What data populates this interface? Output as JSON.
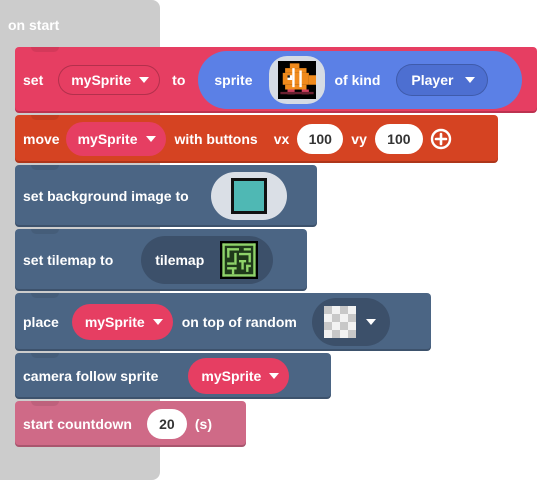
{
  "on_start": {
    "label": "on start"
  },
  "set_sprite": {
    "set_label": "set",
    "var": "mySprite",
    "to_label": "to",
    "sprite_label": "sprite",
    "of_kind_label": "of kind",
    "kind": "Player"
  },
  "move": {
    "label": "move",
    "var": "mySprite",
    "with_buttons_label": "with buttons",
    "vx_label": "vx",
    "vx_value": "100",
    "vy_label": "vy",
    "vy_value": "100"
  },
  "background": {
    "label": "set background image to"
  },
  "tilemap": {
    "label": "set tilemap to",
    "field_label": "tilemap"
  },
  "place": {
    "label": "place",
    "var": "mySprite",
    "on_top_label": "on top of random"
  },
  "camera": {
    "label": "camera follow sprite",
    "var": "mySprite"
  },
  "countdown": {
    "label": "start countdown",
    "value": "20",
    "unit": "(s)"
  },
  "colors": {
    "sprites": "#e63e62",
    "controller": "#d54322",
    "scene": "#4b6584",
    "info": "#cf6a87",
    "variable_pill": "#e63e62",
    "sprite_pill": "#5b80e6",
    "kind_pill": "#4d6fd1"
  },
  "icons": [
    "fish-sprite-thumbnail",
    "teal-square-image",
    "maze-tilemap-thumbnail",
    "transparent-tile-thumbnail",
    "add-circle-icon",
    "dropdown-caret"
  ]
}
